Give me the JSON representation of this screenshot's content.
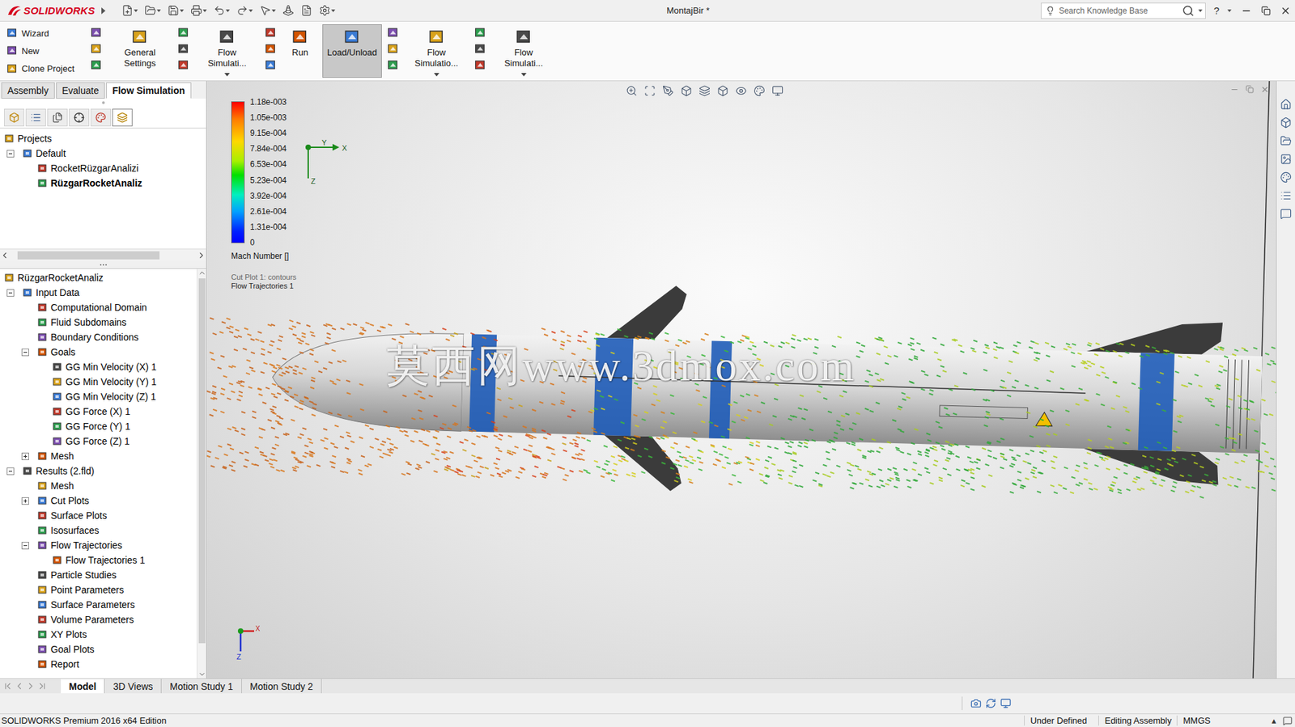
{
  "window": {
    "app": "SOLIDWORKS",
    "title": "MontajBir *",
    "search_placeholder": "Search Knowledge Base",
    "help": "?"
  },
  "ribbon": [
    {
      "kind": "stack",
      "labels": [
        "Wizard",
        "New",
        "Clone Project"
      ]
    },
    {
      "kind": "icons"
    },
    {
      "kind": "large",
      "label": "General Settings",
      "pressed": false,
      "dropdown": false
    },
    {
      "kind": "icons"
    },
    {
      "kind": "large",
      "label": "Flow Simulati...",
      "pressed": false,
      "dropdown": true
    },
    {
      "kind": "icons"
    },
    {
      "kind": "large",
      "label": "Run",
      "pressed": false,
      "dropdown": false
    },
    {
      "kind": "large",
      "label": "Load/Unload",
      "pressed": true,
      "dropdown": false
    },
    {
      "kind": "icons"
    },
    {
      "kind": "large",
      "label": "Flow Simulatio...",
      "pressed": false,
      "dropdown": true
    },
    {
      "kind": "icons"
    },
    {
      "kind": "large",
      "label": "Flow Simulati...",
      "pressed": false,
      "dropdown": true
    }
  ],
  "command_tabs": [
    {
      "label": "Assembly",
      "selected": false
    },
    {
      "label": "Evaluate",
      "selected": false
    },
    {
      "label": "Flow Simulation",
      "selected": true
    }
  ],
  "panel_tabs": [
    {
      "selected": false
    },
    {
      "selected": false
    },
    {
      "selected": false
    },
    {
      "selected": false
    },
    {
      "selected": false
    },
    {
      "selected": true
    }
  ],
  "projects_tree": [
    {
      "label": "Projects",
      "kind": "root",
      "expanded": true,
      "active": false,
      "children": [
        {
          "label": "Default",
          "kind": "branch",
          "expanded": true,
          "active": false,
          "children": [
            {
              "label": "RocketRüzgarAnalizi",
              "kind": "leaf",
              "expanded": false,
              "active": false
            },
            {
              "label": "RüzgarRocketAnaliz",
              "kind": "leaf",
              "expanded": false,
              "active": true
            }
          ]
        }
      ]
    }
  ],
  "analysis_tree": [
    {
      "label": "RüzgarRocketAnaliz",
      "kind": "root",
      "expanded": true,
      "active": false,
      "children": [
        {
          "label": "Input Data",
          "kind": "branch",
          "expanded": true,
          "active": false,
          "children": [
            {
              "label": "Computational Domain",
              "kind": "leaf",
              "expanded": false,
              "active": false
            },
            {
              "label": "Fluid Subdomains",
              "kind": "leaf",
              "expanded": false,
              "active": false
            },
            {
              "label": "Boundary Conditions",
              "kind": "leaf",
              "expanded": false,
              "active": false
            },
            {
              "label": "Goals",
              "kind": "branch",
              "expanded": true,
              "active": false,
              "children": [
                {
                  "label": "GG Min Velocity (X) 1",
                  "kind": "leaf",
                  "expanded": false,
                  "active": false
                },
                {
                  "label": "GG Min Velocity (Y) 1",
                  "kind": "leaf",
                  "expanded": false,
                  "active": false
                },
                {
                  "label": "GG Min Velocity (Z) 1",
                  "kind": "leaf",
                  "expanded": false,
                  "active": false
                },
                {
                  "label": "GG Force (X) 1",
                  "kind": "leaf",
                  "expanded": false,
                  "active": false
                },
                {
                  "label": "GG Force (Y) 1",
                  "kind": "leaf",
                  "expanded": false,
                  "active": false
                },
                {
                  "label": "GG Force (Z) 1",
                  "kind": "leaf",
                  "expanded": false,
                  "active": false
                }
              ]
            },
            {
              "label": "Mesh",
              "kind": "branch",
              "expanded": false,
              "active": false
            }
          ]
        },
        {
          "label": "Results (2.fld)",
          "kind": "branch",
          "expanded": true,
          "active": false,
          "children": [
            {
              "label": "Mesh",
              "kind": "leaf",
              "expanded": false,
              "active": false
            },
            {
              "label": "Cut Plots",
              "kind": "branch",
              "expanded": false,
              "active": false
            },
            {
              "label": "Surface Plots",
              "kind": "leaf",
              "expanded": false,
              "active": false
            },
            {
              "label": "Isosurfaces",
              "kind": "leaf",
              "expanded": false,
              "active": false
            },
            {
              "label": "Flow Trajectories",
              "kind": "branch",
              "expanded": true,
              "active": false,
              "children": [
                {
                  "label": "Flow Trajectories 1",
                  "kind": "leaf",
                  "expanded": false,
                  "active": false
                }
              ]
            },
            {
              "label": "Particle Studies",
              "kind": "leaf",
              "expanded": false,
              "active": false
            },
            {
              "label": "Point Parameters",
              "kind": "leaf",
              "expanded": false,
              "active": false
            },
            {
              "label": "Surface Parameters",
              "kind": "leaf",
              "expanded": false,
              "active": false
            },
            {
              "label": "Volume Parameters",
              "kind": "leaf",
              "expanded": false,
              "active": false
            },
            {
              "label": "XY Plots",
              "kind": "leaf",
              "expanded": false,
              "active": false
            },
            {
              "label": "Goal Plots",
              "kind": "leaf",
              "expanded": false,
              "active": false
            },
            {
              "label": "Report",
              "kind": "leaf",
              "expanded": false,
              "active": false
            }
          ]
        }
      ]
    }
  ],
  "legend": {
    "values": [
      "1.18e-003",
      "1.05e-003",
      "9.15e-004",
      "7.84e-004",
      "6.53e-004",
      "5.23e-004",
      "3.92e-004",
      "2.61e-004",
      "1.31e-004",
      "0"
    ],
    "quantity": "Mach Number []",
    "notes": [
      "Cut Plot 1: contours",
      "Flow Trajectories 1"
    ]
  },
  "triad": {
    "x": "X",
    "y": "Y",
    "z": "Z"
  },
  "watermark": "莫西网www.3dmox.com",
  "bottom_tabs": [
    {
      "label": "Model",
      "selected": true
    },
    {
      "label": "3D Views",
      "selected": false
    },
    {
      "label": "Motion Study 1",
      "selected": false
    },
    {
      "label": "Motion Study 2",
      "selected": false
    }
  ],
  "status_bar": {
    "edition": "SOLIDWORKS Premium 2016 x64 Edition",
    "items": [
      "Under Defined",
      "Editing Assembly",
      "MMGS"
    ],
    "toggle": "▴"
  }
}
